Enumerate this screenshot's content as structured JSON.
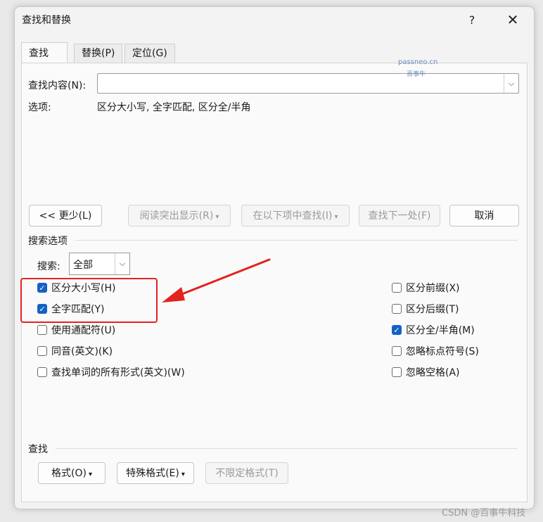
{
  "dialog": {
    "title": "查找和替换",
    "help_glyph": "?",
    "close_glyph": "✕"
  },
  "tabs": [
    {
      "label": "查找(D)"
    },
    {
      "label": "替换(P)"
    },
    {
      "label": "定位(G)"
    }
  ],
  "find": {
    "label": "查找内容(N):",
    "value": "",
    "dropdown_glyph": "⌵"
  },
  "options": {
    "label": "选项:",
    "value": "区分大小写, 全字匹配, 区分全/半角"
  },
  "watermark": {
    "line1": "passneo.cn",
    "line2": "百事牛"
  },
  "buttons": {
    "less": "<< 更少(L)",
    "reading_highlight": "阅读突出显示(R)",
    "find_in": "在以下项中查找(I)",
    "find_next": "查找下一处(F)",
    "cancel": "取消",
    "caret": "▾"
  },
  "search_options": {
    "title": "搜索选项",
    "search_label": "搜索:",
    "search_value": "全部",
    "left": [
      {
        "label": "区分大小写(H)",
        "checked": true
      },
      {
        "label": "全字匹配(Y)",
        "checked": true
      },
      {
        "label": "使用通配符(U)",
        "checked": false
      },
      {
        "label": "同音(英文)(K)",
        "checked": false
      },
      {
        "label": "查找单词的所有形式(英文)(W)",
        "checked": false
      }
    ],
    "right": [
      {
        "label": "区分前缀(X)",
        "checked": false
      },
      {
        "label": "区分后缀(T)",
        "checked": false
      },
      {
        "label": "区分全/半角(M)",
        "checked": true
      },
      {
        "label": "忽略标点符号(S)",
        "checked": false
      },
      {
        "label": "忽略空格(A)",
        "checked": false
      }
    ]
  },
  "find_section": {
    "title": "查找",
    "format": "格式(O)",
    "special": "特殊格式(E)",
    "no_format": "不限定格式(T)"
  },
  "footer": {
    "credit": "CSDN @百事牛科技"
  },
  "colors": {
    "accent": "#1461c5",
    "annotation": "#e3231f"
  }
}
